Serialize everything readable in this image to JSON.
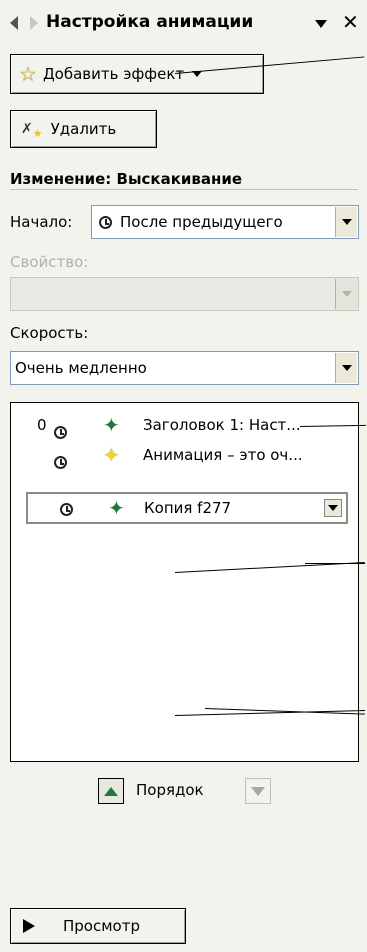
{
  "header": {
    "title": "Настройка анимации"
  },
  "toolbar": {
    "add_effect_label": "Добавить эффект",
    "remove_label": "Удалить"
  },
  "change_section": {
    "heading": "Изменение: Выскакивание",
    "start_label": "Начало:",
    "start_value": "После предыдущего",
    "property_label": "Свойство:",
    "property_value": "",
    "speed_label": "Скорость:",
    "speed_value": "Очень медленно"
  },
  "animation_list": {
    "items": [
      {
        "order": "0",
        "label": "Заголовок 1: Наст...",
        "selected": false
      },
      {
        "order": "",
        "label": "Анимация – это оч...",
        "selected": false
      },
      {
        "order": "",
        "label": "Копия f277",
        "selected": true
      }
    ]
  },
  "reorder": {
    "label": "Порядок"
  },
  "play": {
    "label": "Просмотр"
  },
  "colors": {
    "panel_bg": "#f3f3ee",
    "accent_green": "#1f7a3a",
    "star_yellow": "#f2d22a"
  }
}
